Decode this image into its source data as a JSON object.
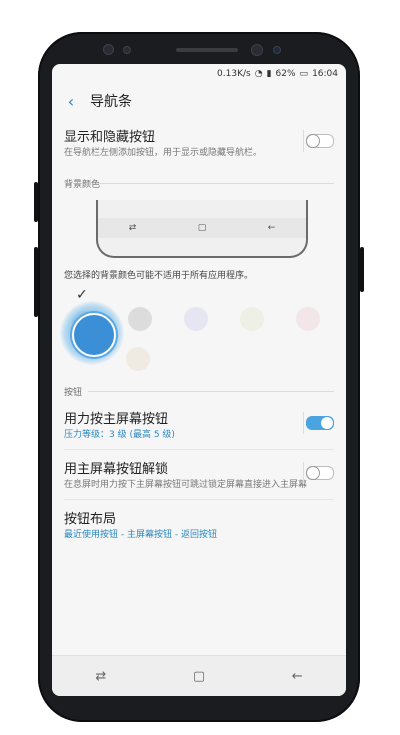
{
  "status": {
    "net_speed": "0.13K/s",
    "battery": "62%",
    "time": "16:04"
  },
  "appbar": {
    "title": "导航条"
  },
  "rows": {
    "show_hide": {
      "title": "显示和隐藏按钮",
      "subtitle": "在导航栏左侧添加按钮，用于显示或隐藏导航栏。",
      "toggle_on": false
    },
    "press_home": {
      "title": "用力按主屏幕按钮",
      "subtitle": "压力等级：3 级 (最高 5 级)",
      "toggle_on": true
    },
    "unlock_home": {
      "title": "用主屏幕按钮解锁",
      "subtitle": "在息屏时用力按下主屏幕按钮可跳过锁定屏幕直接进入主屏幕",
      "toggle_on": false
    },
    "layout": {
      "title": "按钮布局",
      "subtitle": "最近使用按钮 - 主屏幕按钮 - 返回按钮"
    }
  },
  "sections": {
    "bg_color": "背景颜色",
    "buttons": "按钮"
  },
  "note": "您选择的背景颜色可能不适用于所有应用程序。",
  "preview_icons": [
    "recent",
    "home",
    "back"
  ],
  "colors": [
    "#e8e8e8",
    "#dcdcdc",
    "#e6e6f3",
    "#eef0e6",
    "#f2e6e9",
    "#f0ebe2"
  ],
  "nav_icons": [
    "recent-icon",
    "home-icon",
    "back-icon"
  ],
  "accent": "#4ba3e0"
}
